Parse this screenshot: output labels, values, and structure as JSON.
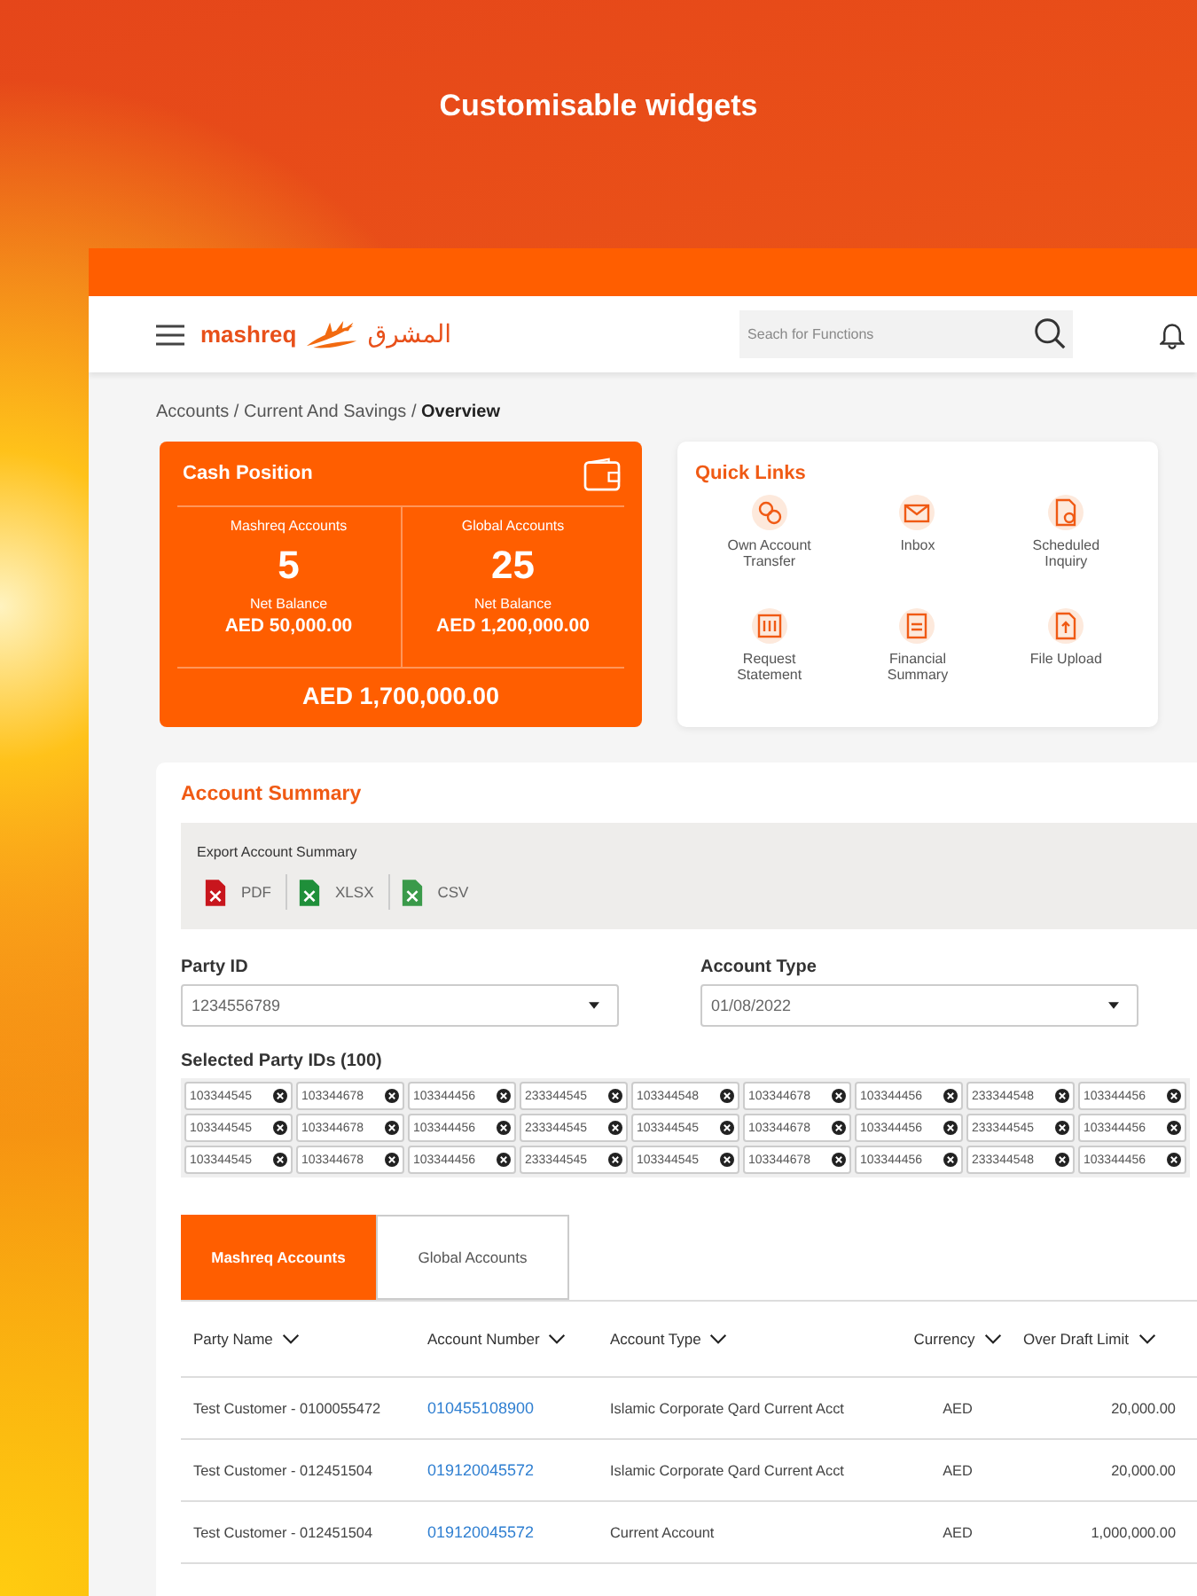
{
  "headline": "Customisable widgets",
  "header": {
    "logo_text": "mashreq",
    "logo_arabic": "المشرق",
    "search": {
      "placeholder": "Seach for Functions"
    }
  },
  "breadcrumb": "Accounts / Current And Savings / **Overview**",
  "cash_position": {
    "title": "Cash Position",
    "accounts": [
      {
        "label": "Mashreq Accounts",
        "count": "5",
        "balance_label": "Net Balance",
        "balance": "AED 50,000.00"
      },
      {
        "label": "Global Accounts",
        "count": "25",
        "balance_label": "Net Balance",
        "balance": "AED 1,200,000.00"
      }
    ],
    "total": "AED 1,700,000.00"
  },
  "quick_links": {
    "title": "Quick Links",
    "items": [
      {
        "label": "Own Account Transfer"
      },
      {
        "label": "Inbox"
      },
      {
        "label": "Scheduled Inquiry"
      },
      {
        "label": "Request Statement"
      },
      {
        "label": "Financial Summary"
      },
      {
        "label": "File Upload"
      }
    ]
  },
  "account_summary": {
    "title": "Account Summary",
    "export": {
      "label": "Export Account Summary",
      "formats": [
        {
          "kind": "pdf",
          "label": "PDF"
        },
        {
          "kind": "xlsx",
          "label": "XLSX"
        },
        {
          "kind": "csv",
          "label": "CSV"
        }
      ]
    },
    "filters": [
      {
        "label": "Party ID",
        "value": "1234556789"
      },
      {
        "label": "Account Type",
        "value": "01/08/2022"
      }
    ],
    "selected_ids": {
      "label": "Selected Party IDs (100)",
      "chips": [
        "103344545",
        "103344678",
        "103344456",
        "233344545",
        "103344548",
        "103344678",
        "103344456",
        "233344548",
        "103344456",
        "103344545",
        "103344678",
        "103344456",
        "233344545",
        "103344545",
        "103344678",
        "103344456",
        "233344545",
        "103344456",
        "103344545",
        "103344678",
        "103344456",
        "233344545",
        "103344545",
        "103344678",
        "103344456",
        "233344548",
        "103344456"
      ]
    },
    "tabs": [
      {
        "label": "Mashreq Accounts",
        "selected": true
      },
      {
        "label": "Global Accounts",
        "selected": false
      }
    ],
    "table": {
      "columns": [
        "Party Name",
        "Account Number",
        "Account Type",
        "Currency",
        "Over Draft Limit"
      ],
      "rows": [
        [
          "Test Customer - 0100055472",
          "010455108900",
          "Islamic Corporate Qard Current Acct",
          "AED",
          "20,000.00"
        ],
        [
          "Test Customer - 012451504",
          "019120045572",
          "Islamic Corporate Qard Current Acct",
          "AED",
          "20,000.00"
        ],
        [
          "Test Customer - 012451504",
          "019120045572",
          "Current Account",
          "AED",
          "1,000,000.00"
        ]
      ]
    }
  }
}
